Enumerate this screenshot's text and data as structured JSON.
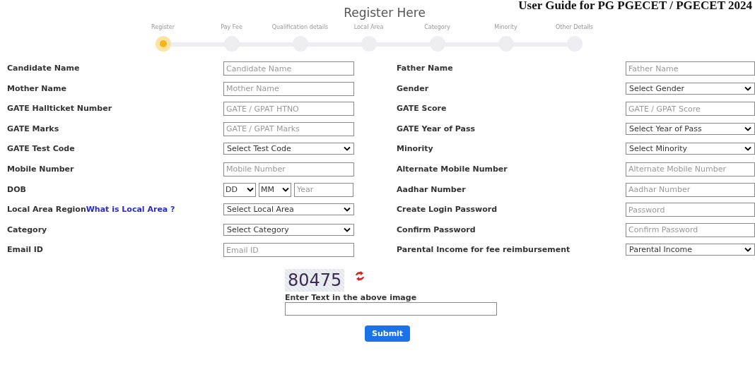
{
  "guide_title": "User Guide for PG PGECET / PGECET 2024",
  "title": "Register Here",
  "steps": [
    {
      "label": "Register",
      "selected": true
    },
    {
      "label": "Pay Fee",
      "selected": false
    },
    {
      "label": "Qualification details",
      "selected": false
    },
    {
      "label": "Local Area",
      "selected": false
    },
    {
      "label": "Category",
      "selected": false
    },
    {
      "label": "Minority",
      "selected": false
    },
    {
      "label": "Other Details",
      "selected": false
    }
  ],
  "rows": [
    {
      "left": {
        "label": "Candidate Name",
        "kind": "text",
        "placeholder": "Candidate Name"
      },
      "right": {
        "label": "Father Name",
        "kind": "text",
        "placeholder": "Father Name"
      }
    },
    {
      "left": {
        "label": "Mother Name",
        "kind": "text",
        "placeholder": "Mother Name"
      },
      "right": {
        "label": "Gender",
        "kind": "select",
        "value": "Select Gender"
      }
    },
    {
      "left": {
        "label": "GATE Hallticket Number",
        "kind": "text",
        "placeholder": "GATE / GPAT HTNO"
      },
      "right": {
        "label": "GATE Score",
        "kind": "text",
        "placeholder": "GATE / GPAT Score"
      }
    },
    {
      "left": {
        "label": "GATE Marks",
        "kind": "text",
        "placeholder": "GATE / GPAT Marks"
      },
      "right": {
        "label": "GATE Year of Pass",
        "kind": "select",
        "value": "Select Year of Pass"
      }
    },
    {
      "left": {
        "label": "GATE Test Code",
        "kind": "select",
        "value": "Select Test Code"
      },
      "right": {
        "label": "Minority",
        "kind": "select",
        "value": "Select Minority"
      }
    },
    {
      "left": {
        "label": "Mobile Number",
        "kind": "text",
        "placeholder": "Mobile Number"
      },
      "right": {
        "label": "Alternate Mobile Number",
        "kind": "text",
        "placeholder": "Alternate Mobile Number"
      }
    },
    {
      "left": {
        "label": "DOB",
        "kind": "dob",
        "day": "DD",
        "month": "MM",
        "year_placeholder": "Year"
      },
      "right": {
        "label": "Aadhar Number",
        "kind": "text",
        "placeholder": "Aadhar Number"
      }
    },
    {
      "left": {
        "label": "Local Area Region",
        "link": "What is Local Area ?",
        "kind": "select",
        "value": "Select Local Area"
      },
      "right": {
        "label": "Create Login Password",
        "kind": "text",
        "placeholder": "Password"
      }
    },
    {
      "left": {
        "label": "Category",
        "kind": "select",
        "value": "Select Category"
      },
      "right": {
        "label": "Confirm Password",
        "kind": "text",
        "placeholder": "Confirm Password"
      }
    },
    {
      "left": {
        "label": "Email ID",
        "kind": "text",
        "placeholder": "Email ID"
      },
      "right": {
        "label": "Parental Income for fee reimbursement",
        "kind": "select",
        "value": "Parental Income"
      }
    }
  ],
  "captcha": {
    "code": "80475",
    "label": "Enter Text in the above image"
  },
  "submit": "Submit"
}
